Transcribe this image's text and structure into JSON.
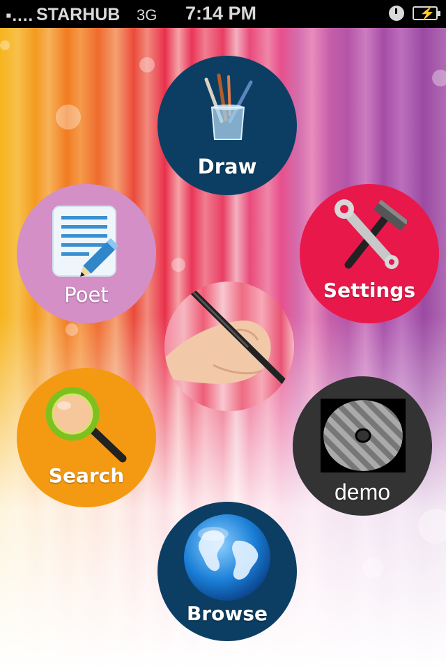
{
  "status_bar": {
    "signal": "▪....",
    "carrier": "STARHUB",
    "network": "3G",
    "time": "7:14 PM",
    "alarm_icon": "clock-icon",
    "battery_icon": "battery-charging-icon"
  },
  "menu": {
    "draw": {
      "label": "Draw",
      "icon": "paintbrush-jar-icon",
      "color": "#0c3e63"
    },
    "poet": {
      "label": "Poet",
      "icon": "notepad-pencil-icon",
      "color": "#d38fc6"
    },
    "settings": {
      "label": "Settings",
      "icon": "wrench-hammer-icon",
      "color": "#e8194a"
    },
    "search": {
      "label": "Search",
      "icon": "magnifier-icon",
      "color": "#f49a12"
    },
    "demo": {
      "label": "demo",
      "icon": "disc-icon",
      "color": "#333333"
    },
    "browse": {
      "label": "Browse",
      "icon": "globe-icon",
      "color": "#0c3e63"
    }
  },
  "center": {
    "image": "hand-writing-pen-image"
  }
}
